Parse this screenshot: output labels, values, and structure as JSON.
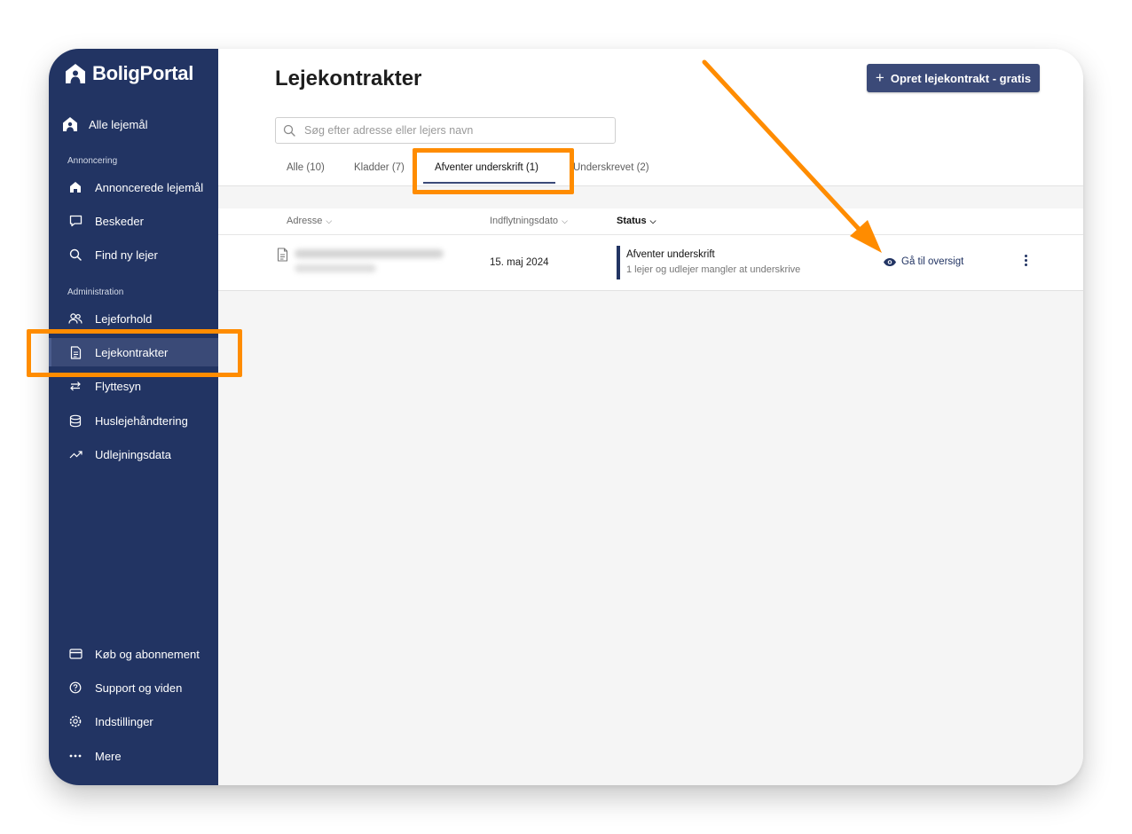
{
  "brand": {
    "name": "BoligPortal"
  },
  "sidebar": {
    "top_item": {
      "label": "Alle lejemål",
      "icon": "home-person-icon"
    },
    "sections": [
      {
        "label": "Annoncering"
      },
      {
        "label": "Administration"
      }
    ],
    "items": [
      {
        "label": "Annoncerede lejemål",
        "icon": "house-icon"
      },
      {
        "label": "Beskeder",
        "icon": "chat-icon"
      },
      {
        "label": "Find ny lejer",
        "icon": "search-icon"
      },
      {
        "label": "Lejeforhold",
        "icon": "people-icon"
      },
      {
        "label": "Lejekontrakter",
        "icon": "document-icon",
        "active": true
      },
      {
        "label": "Flyttesyn",
        "icon": "swap-arrows-icon"
      },
      {
        "label": "Huslejehåndtering",
        "icon": "coins-icon"
      },
      {
        "label": "Udlejningsdata",
        "icon": "trend-icon"
      }
    ],
    "bottom_items": [
      {
        "label": "Køb og abonnement",
        "icon": "card-icon"
      },
      {
        "label": "Support og viden",
        "icon": "help-icon"
      },
      {
        "label": "Indstillinger",
        "icon": "settings-icon"
      },
      {
        "label": "Mere",
        "icon": "more-dots-icon"
      }
    ]
  },
  "main": {
    "title": "Lejekontrakter",
    "create_button": "Opret lejekontrakt - gratis",
    "search_placeholder": "Søg efter adresse eller lejers navn",
    "tabs": [
      {
        "label": "Alle (10)"
      },
      {
        "label": "Kladder (7)"
      },
      {
        "label": "Afventer underskrift (1)",
        "active": true
      },
      {
        "label": "Underskrevet (2)"
      }
    ],
    "columns": [
      {
        "label": "Adresse"
      },
      {
        "label": "Indflytningsdato"
      },
      {
        "label": "Status"
      }
    ],
    "rows": [
      {
        "move_in_date": "15. maj 2024",
        "status_title": "Afventer underskrift",
        "status_sub": "1 lejer og udlejer mangler at underskrive",
        "action": "Gå til oversigt"
      }
    ]
  },
  "colors": {
    "sidebar": "#223463",
    "accent": "#3b4a78",
    "highlight": "#ff8c00"
  }
}
